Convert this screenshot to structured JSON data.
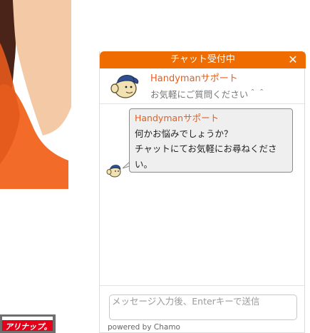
{
  "chat": {
    "header_title": "チャット受付中",
    "close_glyph": "✕",
    "agent_name": "Handymanサポート",
    "agent_status": "お気軽にご質問ください＾＾",
    "message": {
      "sender": "Handymanサポート",
      "line1": "何かお悩みでしょうか？",
      "line2": "チャットにてお気軽にお尋ねくださ",
      "line3": "い。"
    },
    "input_placeholder": "メッセージ入力後、Enterキーで送信",
    "powered_by": "powered by Chamo"
  },
  "banner": {
    "text": "アリナップ。"
  },
  "colors": {
    "header": "#ef6c00",
    "accent_text": "#e2601f",
    "bubble_bg": "#efefef",
    "banner_red": "#e2001a"
  },
  "icons": {
    "close": "close-icon",
    "agent_avatar": "mascot-avatar-icon",
    "message_avatar": "mascot-avatar-icon"
  }
}
